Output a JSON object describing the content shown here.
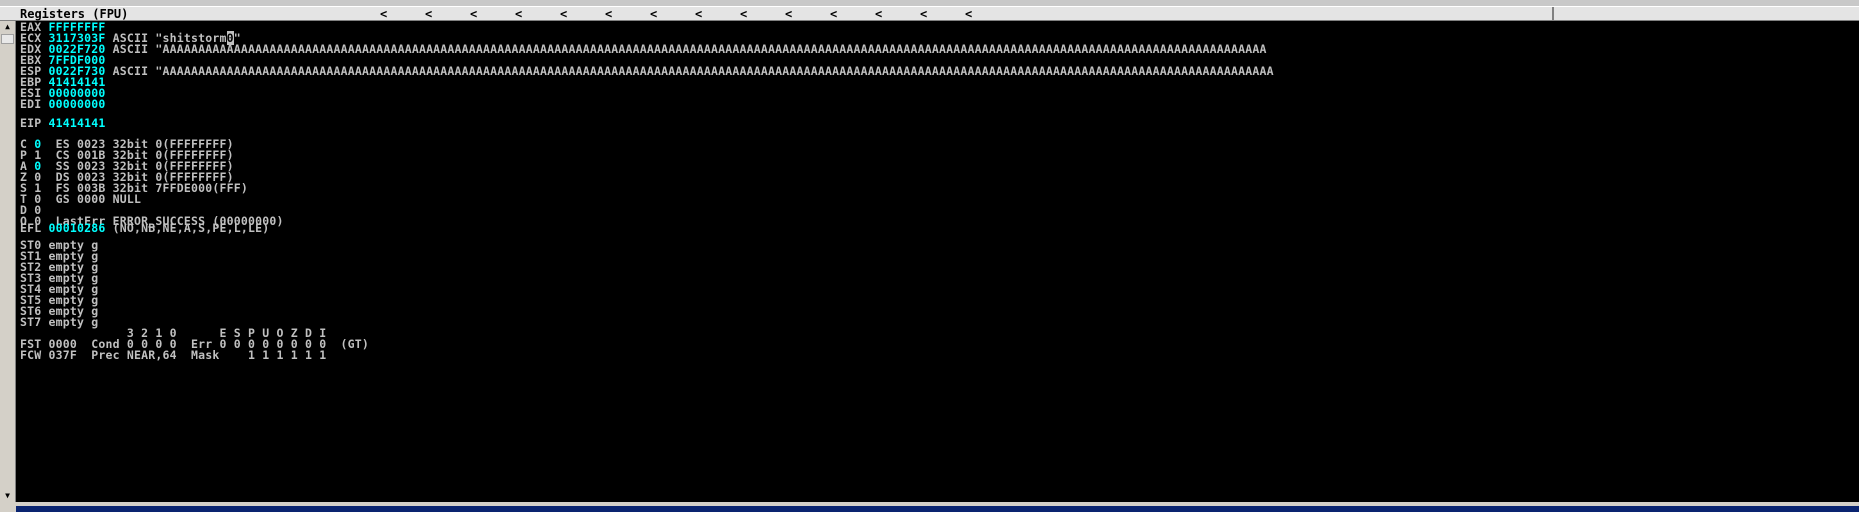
{
  "title": "Registers (FPU)",
  "title_arrows": [
    "<",
    "<",
    "<",
    "<",
    "<",
    "<",
    "<",
    "<",
    "<",
    "<",
    "<",
    "<",
    "<",
    "<"
  ],
  "registers": {
    "eax": {
      "name": "EAX",
      "value": "FFFFFFFF"
    },
    "ecx": {
      "name": "ECX",
      "value": "3117303F",
      "comment_prefix": "ASCII \"shitstorm",
      "cursor_char": "0",
      "comment_suffix": "\""
    },
    "edx": {
      "name": "EDX",
      "value": "0022F720",
      "comment": "ASCII \"AAAAAAAAAAAAAAAAAAAAAAAAAAAAAAAAAAAAAAAAAAAAAAAAAAAAAAAAAAAAAAAAAAAAAAAAAAAAAAAAAAAAAAAAAAAAAAAAAAAAAAAAAAAAAAAAAAAAAAAAAAAAAAAAAAAAAAAAAAAAAAAAAAAAAAAAAAA"
    },
    "ebx": {
      "name": "EBX",
      "value": "7FFDF000"
    },
    "esp": {
      "name": "ESP",
      "value": "0022F730",
      "comment": "ASCII \"AAAAAAAAAAAAAAAAAAAAAAAAAAAAAAAAAAAAAAAAAAAAAAAAAAAAAAAAAAAAAAAAAAAAAAAAAAAAAAAAAAAAAAAAAAAAAAAAAAAAAAAAAAAAAAAAAAAAAAAAAAAAAAAAAAAAAAAAAAAAAAAAAAAAAAAAAAAA"
    },
    "ebp": {
      "name": "EBP",
      "value": "41414141"
    },
    "esi": {
      "name": "ESI",
      "value": "00000000"
    },
    "edi": {
      "name": "EDI",
      "value": "00000000"
    },
    "eip": {
      "name": "EIP",
      "value": "41414141"
    }
  },
  "flags": [
    {
      "flag": "C",
      "val": "0",
      "highlight": true,
      "seg": "  ES 0023 32bit 0(FFFFFFFF)"
    },
    {
      "flag": "P",
      "val": "1",
      "highlight": false,
      "seg": "  CS 001B 32bit 0(FFFFFFFF)"
    },
    {
      "flag": "A",
      "val": "0",
      "highlight": true,
      "seg": "  SS 0023 32bit 0(FFFFFFFF)"
    },
    {
      "flag": "Z",
      "val": "0",
      "highlight": false,
      "seg": "  DS 0023 32bit 0(FFFFFFFF)"
    },
    {
      "flag": "S",
      "val": "1",
      "highlight": false,
      "seg": "  FS 003B 32bit 7FFDE000(FFF)"
    },
    {
      "flag": "T",
      "val": "0",
      "highlight": false,
      "seg": "  GS 0000 NULL"
    },
    {
      "flag": "D",
      "val": "0",
      "highlight": false,
      "seg": ""
    },
    {
      "flag": "O",
      "val": "0",
      "highlight": false,
      "seg": "  LastErr ERROR_SUCCESS (00000000)"
    }
  ],
  "efl": {
    "name": "EFL",
    "value": "00010286",
    "comment": "(NO,NB,NE,A,S,PE,L,LE)"
  },
  "fpu_stack": [
    {
      "name": "ST0",
      "value": "empty g"
    },
    {
      "name": "ST1",
      "value": "empty g"
    },
    {
      "name": "ST2",
      "value": "empty g"
    },
    {
      "name": "ST3",
      "value": "empty g"
    },
    {
      "name": "ST4",
      "value": "empty g"
    },
    {
      "name": "ST5",
      "value": "empty g"
    },
    {
      "name": "ST6",
      "value": "empty g"
    },
    {
      "name": "ST7",
      "value": "empty g"
    }
  ],
  "fpu_header": "               3 2 1 0      E S P U O Z D I",
  "fst": "FST 0000  Cond 0 0 0 0  Err 0 0 0 0 0 0 0 0  (GT)",
  "fcw": "FCW 037F  Prec NEAR,64  Mask    1 1 1 1 1 1",
  "colors": {
    "value": "#00FFFF",
    "text": "#C0C0C0",
    "background": "#000000",
    "title_bar": "#E4E4E4"
  },
  "icons": {
    "scroll_up": "scroll-up-icon",
    "scroll_down": "scroll-down-icon"
  }
}
